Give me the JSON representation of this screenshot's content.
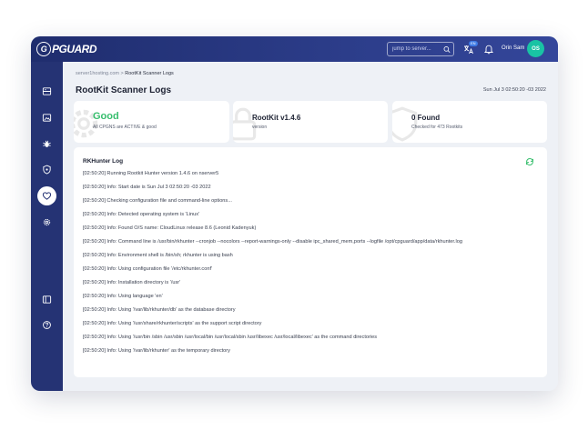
{
  "topbar": {
    "logo_text": "PGUARD",
    "logo_mark": "G",
    "search_placeholder": "jump to server...",
    "lang_badge": "EN",
    "user_name": "Orin Sam",
    "avatar_initials": "OS"
  },
  "sidebar": {
    "items": [
      {
        "icon": "server-icon",
        "active": false
      },
      {
        "icon": "image-icon",
        "active": false
      },
      {
        "icon": "bug-icon",
        "active": false
      },
      {
        "icon": "shield-icon",
        "active": false
      },
      {
        "icon": "heart-shield-icon",
        "active": true
      },
      {
        "icon": "gear-icon",
        "active": false
      },
      {
        "icon": "collapse-icon",
        "active": false
      },
      {
        "icon": "help-icon",
        "active": false
      }
    ]
  },
  "breadcrumb": {
    "parent": "server1hosting.com",
    "separator": ">",
    "current": "RootKit Scanner Logs"
  },
  "page": {
    "title": "RootKit Scanner Logs",
    "date": "Sun Jul 3 02:50:20 -03 2022"
  },
  "cards": [
    {
      "value": "Good",
      "sub": "All CPGNS are ACTIVE & good",
      "color": "#37be6d"
    },
    {
      "value": "RootKit v1.4.6",
      "sub": "version"
    },
    {
      "value": "0 Found",
      "sub": "Checked for 473 Rootkits"
    }
  ],
  "log": {
    "title": "RKHunter Log",
    "lines": [
      "[02:50:20] Running Rootkit Hunter version 1.4.6 on nserver5",
      "[02:50:20] Info: Start date is Sun Jul 3 02:50:20 -03 2022",
      "[02:50:20] Checking configuration file and command-line options...",
      "[02:50:20] Info: Detected operating system is 'Linux'",
      "[02:50:20] Info: Found O/S name: CloudLinux release 8.6 (Leonid Kadenyuk)",
      "[02:50:20] Info: Command line is /usr/bin/rkhunter --cronjob --nocolors --report-warnings-only --disable ipc_shared_mem,ports --logfile /opt/cpguard/app/data/rkhunter.log",
      "[02:50:20] Info: Environment shell is /bin/sh; rkhunter is using bash",
      "[02:50:20] Info: Using configuration file '/etc/rkhunter.conf'",
      "[02:50:20] Info: Installation directory is '/usr'",
      "[02:50:20] Info: Using language 'en'",
      "[02:50:20] Info: Using '/var/lib/rkhunter/db' as the database directory",
      "[02:50:20] Info: Using '/usr/share/rkhunter/scripts' as the support script directory",
      "[02:50:20] Info: Using '/usr/bin /sbin /usr/sbin /usr/local/bin /usr/local/sbin /usr/libexec /usr/local/libexec' as the command directories",
      "[02:50:20] Info: Using '/var/lib/rkhunter' as the temporary directory"
    ]
  },
  "colors": {
    "topbar": "#2c3d8a",
    "sidebar": "#253374",
    "good": "#37be6d",
    "avatar": "#19c3a4",
    "refresh": "#37be6d"
  }
}
